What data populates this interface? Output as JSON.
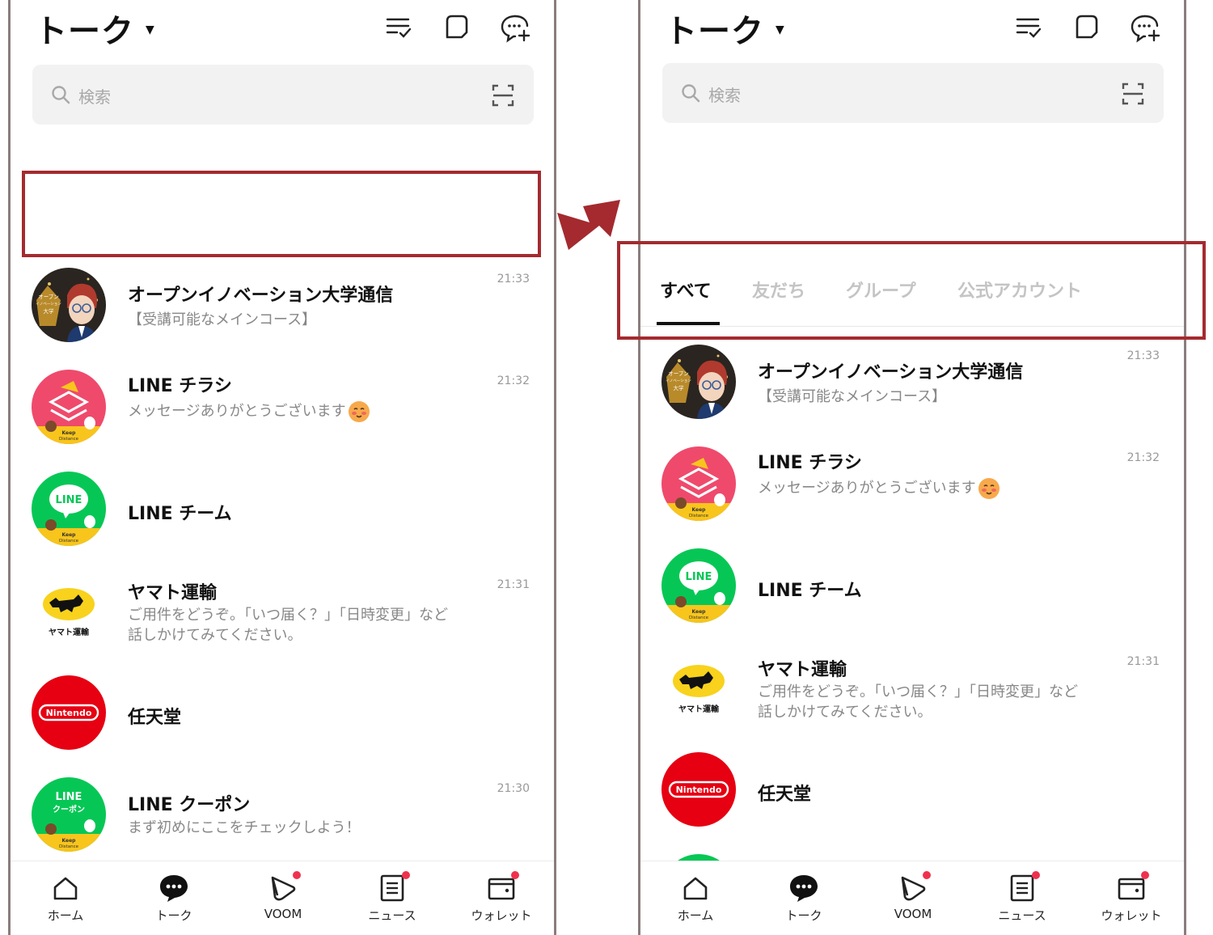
{
  "header": {
    "title": "トーク",
    "icons": [
      "edit-list-icon",
      "keep-icon",
      "new-chat-icon"
    ]
  },
  "search": {
    "placeholder": "検索",
    "icon": "search-icon",
    "scan_icon": "qr-scan-icon"
  },
  "tabs": [
    "すべて",
    "友だち",
    "グループ",
    "公式アカウント"
  ],
  "chats": [
    {
      "name": "オープンイノベーション大学通信",
      "message": "【受講可能なメインコース】",
      "time": "21:33",
      "avatar": "open-innovation"
    },
    {
      "name": "LINE チラシ",
      "message": "メッセージありがとうございます",
      "time": "21:32",
      "avatar": "line-chirashi",
      "emoji": "blush-emoji"
    },
    {
      "name": "LINE チーム",
      "message": "",
      "time": "",
      "avatar": "line-team"
    },
    {
      "name": "ヤマト運輸",
      "message": "ご用件をどうぞ。「いつ届く？」「日時変更」など",
      "message2": "話しかけてみてください。",
      "time": "21:31",
      "avatar": "yamato"
    },
    {
      "name": "任天堂",
      "message": "",
      "time": "",
      "avatar": "nintendo"
    },
    {
      "name": "LINE クーポン",
      "message": "まず初めにここをチェックしよう！",
      "time": "21:30",
      "avatar": "line-coupon"
    }
  ],
  "avatar_text": {
    "line": "LINE",
    "keep": "Keep",
    "distance": "Distance",
    "coupon_line": "LINE",
    "coupon": "クーポン",
    "yamato": "ヤマト運輸",
    "nintendo": "Nintendo",
    "oiu_1": "オープン",
    "oiu_2": "イノベーション",
    "oiu_3": "大学"
  },
  "nav": [
    {
      "label": "ホーム",
      "icon": "home-icon",
      "badge": false
    },
    {
      "label": "トーク",
      "icon": "talk-icon",
      "badge": false
    },
    {
      "label": "VOOM",
      "icon": "voom-icon",
      "badge": true
    },
    {
      "label": "ニュース",
      "icon": "news-icon",
      "badge": true
    },
    {
      "label": "ウォレット",
      "icon": "wallet-icon",
      "badge": true
    }
  ],
  "colors": {
    "highlight": "#a42a2f",
    "line_green": "#06c755",
    "chirashi_pink": "#ef4a6c",
    "keep_yellow": "#f8c51c",
    "nintendo_red": "#e60012",
    "badge_red": "#f0314d"
  }
}
